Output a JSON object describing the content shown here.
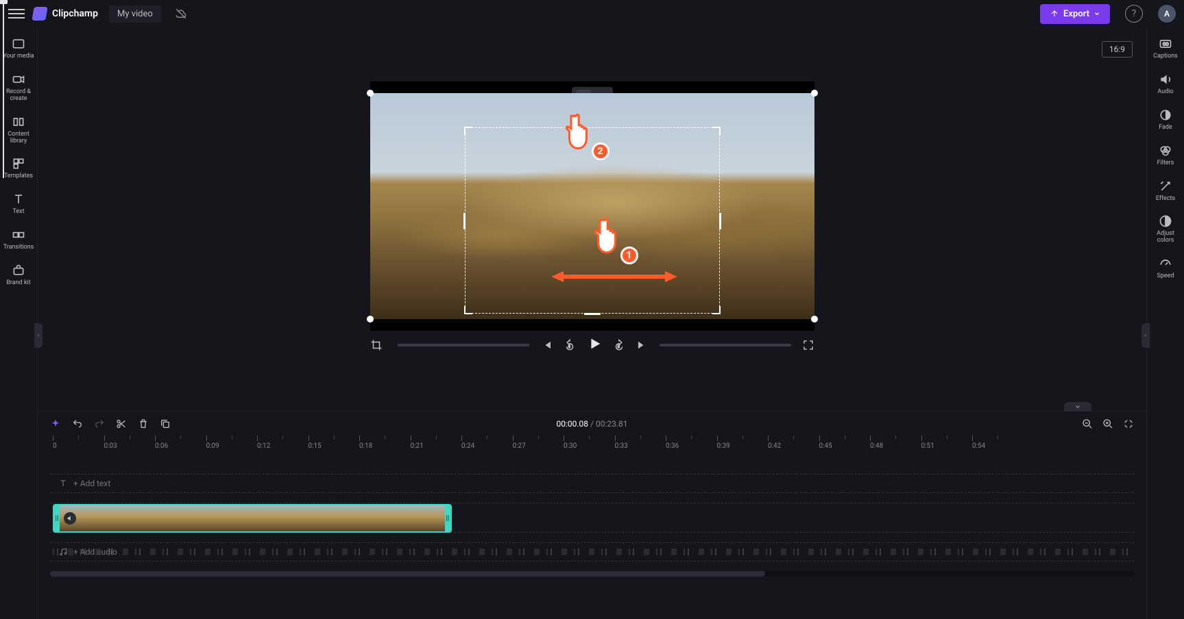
{
  "header": {
    "app_name": "Clipchamp",
    "project_name": "My video",
    "export_label": "Export",
    "avatar_initial": "A"
  },
  "left_rail": [
    {
      "id": "your-media",
      "label": "Your media"
    },
    {
      "id": "record-create",
      "label": "Record & create"
    },
    {
      "id": "content-library",
      "label": "Content library"
    },
    {
      "id": "templates",
      "label": "Templates"
    },
    {
      "id": "text",
      "label": "Text"
    },
    {
      "id": "transitions",
      "label": "Transitions"
    },
    {
      "id": "brand-kit",
      "label": "Brand kit"
    }
  ],
  "right_rail": [
    {
      "id": "captions",
      "label": "Captions"
    },
    {
      "id": "audio",
      "label": "Audio"
    },
    {
      "id": "fade",
      "label": "Fade"
    },
    {
      "id": "filters",
      "label": "Filters"
    },
    {
      "id": "effects",
      "label": "Effects"
    },
    {
      "id": "adjust-colors",
      "label": "Adjust colors"
    },
    {
      "id": "speed",
      "label": "Speed"
    }
  ],
  "preview": {
    "aspect_label": "16:9",
    "annotation_numbers": [
      "1",
      "2"
    ]
  },
  "timecode": {
    "current": "00:00.08",
    "separator": " / ",
    "total": "00:23.81"
  },
  "timeline": {
    "ruler_marks": [
      "0",
      "0:03",
      "0:06",
      "0:09",
      "0:12",
      "0:15",
      "0:18",
      "0:21",
      "0:24",
      "0:27",
      "0:30",
      "0:33",
      "0:36",
      "0:39",
      "0:42",
      "0:45",
      "0:48",
      "0:51",
      "0:54"
    ],
    "add_text_placeholder": "+ Add text",
    "add_audio_placeholder": "+ Add audio"
  }
}
